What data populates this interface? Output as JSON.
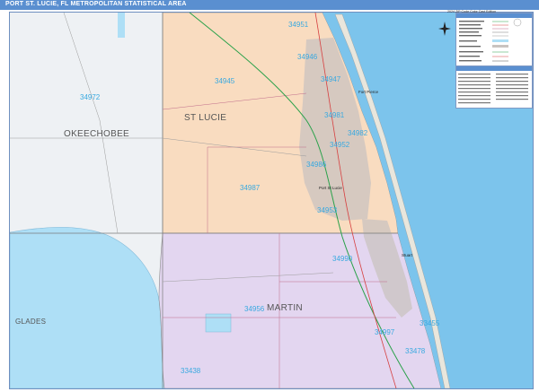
{
  "title": "PORT ST. LUCIE, FL METROPOLITAN STATISTICAL AREA",
  "subtitle": "2024 ZIP Code Color Cast Edition",
  "icons": {
    "compass": "compass-rose-icon",
    "logo": "publisher-logo-icon"
  },
  "colors": {
    "title_bar": "#5a8fd0",
    "ocean": "#7cc4ec",
    "lake": "#aedff6",
    "st_lucie_fill": "#f9dcc0",
    "martin_fill": "#e3d6f0",
    "outside_fill": "#eef1f4",
    "zip_label": "#39a9e0",
    "urban": "#c9c3c0",
    "road_green": "#2aa14a",
    "road_red": "#d64040"
  },
  "counties": {
    "okeechobee": "OKEECHOBEE",
    "st_lucie": "ST LUCIE",
    "martin": "MARTIN",
    "glades": "GLADES"
  },
  "zips": {
    "z34951": "34951",
    "z34946": "34946",
    "z34945": "34945",
    "z34947": "34947",
    "z34972": "34972",
    "z34981": "34981",
    "z34982": "34982",
    "z34952": "34952",
    "z34986": "34986",
    "z34987": "34987",
    "z34953": "34953",
    "z34990": "34990",
    "z34956": "34956",
    "z34997": "34997",
    "z34455": "33455",
    "z33438": "33438",
    "z33478": "33478"
  },
  "cities": {
    "fort_pierce": "Fort Pierce",
    "port_st_lucie": "Port St Lucie",
    "stuart": "Stuart"
  }
}
